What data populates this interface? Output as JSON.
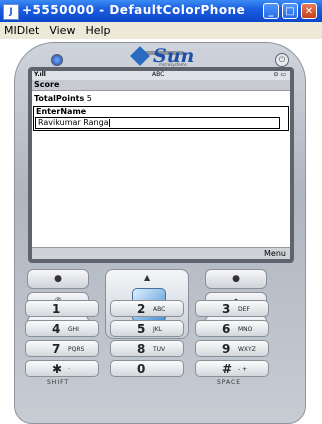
{
  "window": {
    "title": "+5550000 - DefaultColorPhone",
    "icon": "java-midlet-icon",
    "minimize": "_",
    "maximize": "□",
    "close": "✕"
  },
  "menubar": [
    "MIDlet",
    "View",
    "Help"
  ],
  "phone": {
    "brand": "Sun",
    "brand_tag": "microsystems",
    "power_glyph": "⏻"
  },
  "screen": {
    "status": {
      "signal": "Y.ıll",
      "center": "ABC",
      "battery": "⊙ ▭"
    },
    "title": "Score",
    "total_points_label": "TotalPoints",
    "total_points_value": "5",
    "field_label": "EnterName",
    "field_value": "Ravikumar Ranga",
    "softkey_right": "Menu"
  },
  "nav": {
    "left_softkey": "●",
    "right_softkey": "●",
    "call": "✆",
    "end": "⏏",
    "home": "⌂",
    "back": "◂|"
  },
  "keys": [
    {
      "digit": "1",
      "letters": ""
    },
    {
      "digit": "2",
      "letters": "ABC"
    },
    {
      "digit": "3",
      "letters": "DEF"
    },
    {
      "digit": "4",
      "letters": "GHI"
    },
    {
      "digit": "5",
      "letters": "JKL"
    },
    {
      "digit": "6",
      "letters": "MNO"
    },
    {
      "digit": "7",
      "letters": "PQRS"
    },
    {
      "digit": "8",
      "letters": "TUV"
    },
    {
      "digit": "9",
      "letters": "WXYZ"
    },
    {
      "digit": "✱",
      "letters": "·"
    },
    {
      "digit": "0",
      "letters": ""
    },
    {
      "digit": "#",
      "letters": "- +"
    }
  ],
  "key_labels": {
    "shift": "SHIFT",
    "space": "SPACE"
  }
}
